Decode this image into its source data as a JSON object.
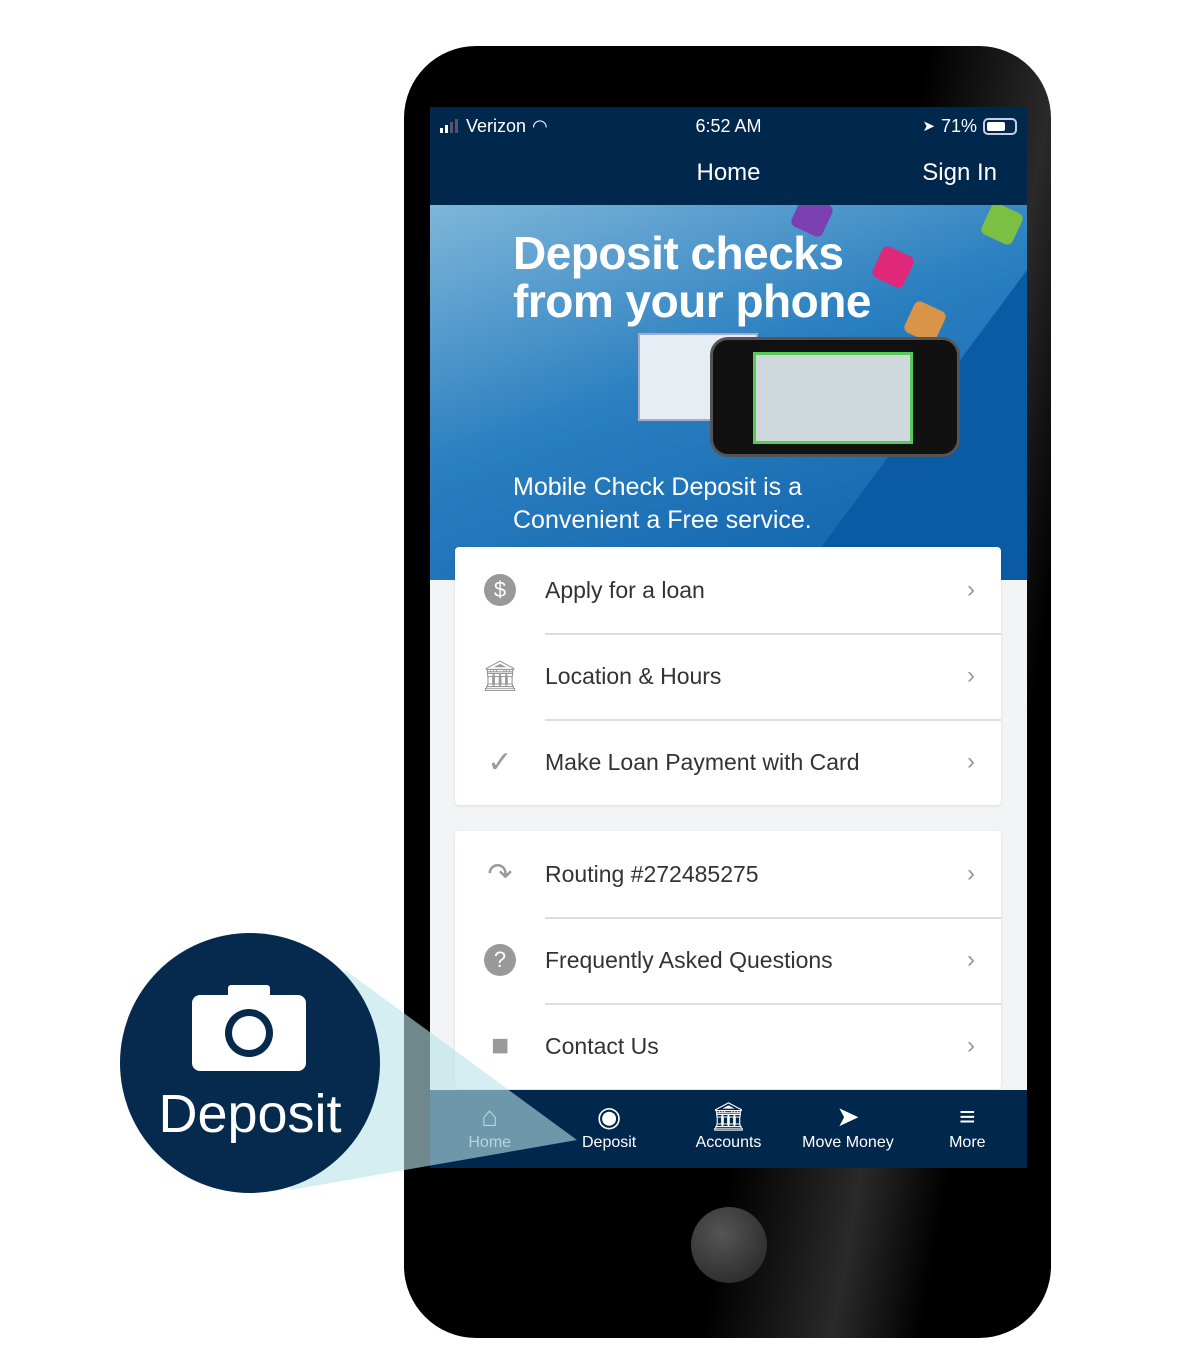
{
  "status_bar": {
    "carrier": "Verizon",
    "time": "6:52 AM",
    "battery": "71%",
    "icons": [
      "signal-icon",
      "wifi-icon",
      "location-icon",
      "battery-icon"
    ]
  },
  "nav": {
    "title": "Home",
    "sign_in": "Sign In"
  },
  "banner": {
    "headline_1": "Deposit checks",
    "headline_2": "from your phone",
    "subtext_1": "Mobile Check Deposit is a",
    "subtext_2": "Convenient a Free service."
  },
  "menu_group_1": [
    {
      "label": "Apply for a loan",
      "icon": "dollar-icon"
    },
    {
      "label": "Location & Hours",
      "icon": "bank-icon"
    },
    {
      "label": "Make Loan Payment with Card",
      "icon": "check-plus-icon"
    }
  ],
  "menu_group_2": [
    {
      "label": "Routing #272485275",
      "icon": "redirect-arrow-icon"
    },
    {
      "label": "Frequently Asked Questions",
      "icon": "question-icon"
    },
    {
      "label": "Contact Us",
      "icon": "chat-icon"
    }
  ],
  "tabs": [
    {
      "label": "Home",
      "icon": "home-icon"
    },
    {
      "label": "Deposit",
      "icon": "camera-icon"
    },
    {
      "label": "Accounts",
      "icon": "bank-icon"
    },
    {
      "label": "Move Money",
      "icon": "send-icon"
    },
    {
      "label": "More",
      "icon": "menu-icon"
    }
  ],
  "callout": {
    "label": "Deposit",
    "icon": "camera-icon"
  },
  "colors": {
    "navy": "#00274c",
    "banner_blue": "#2a7fc0",
    "callout": "#052a4e",
    "beam": "#b8e2e8"
  }
}
